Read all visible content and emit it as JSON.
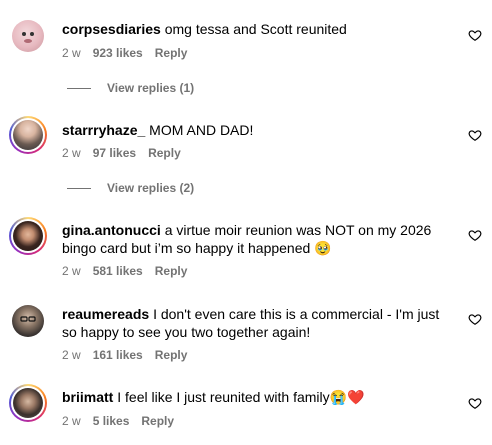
{
  "comments": [
    {
      "username": "corpsesdiaries",
      "text": "omg tessa and Scott reunited",
      "time": "2 w",
      "likes": "923 likes",
      "reply": "Reply",
      "view_replies": "View replies (1)"
    },
    {
      "username": "starrryhaze_",
      "text": "MOM AND DAD!",
      "time": "2 w",
      "likes": "97 likes",
      "reply": "Reply",
      "view_replies": "View replies (2)"
    },
    {
      "username": "gina.antonucci",
      "text": "a virtue moir reunion was NOT on my 2026 bingo card but i’m so happy it happened 🥹",
      "time": "2 w",
      "likes": "581 likes",
      "reply": "Reply"
    },
    {
      "username": "reaumereads",
      "text": "I don't even care this is a commercial - I'm just so happy to see you two together again!",
      "time": "2 w",
      "likes": "161 likes",
      "reply": "Reply"
    },
    {
      "username": "briimatt",
      "text": "I feel like I just reunited with family😭❤️",
      "time": "2 w",
      "likes": "5 likes",
      "reply": "Reply"
    }
  ],
  "icons": {
    "like": "heart-outline-icon"
  },
  "colors": {
    "secondary_text": "#737373",
    "story_ring_start": "#feda75",
    "story_ring_end": "#d62976"
  }
}
